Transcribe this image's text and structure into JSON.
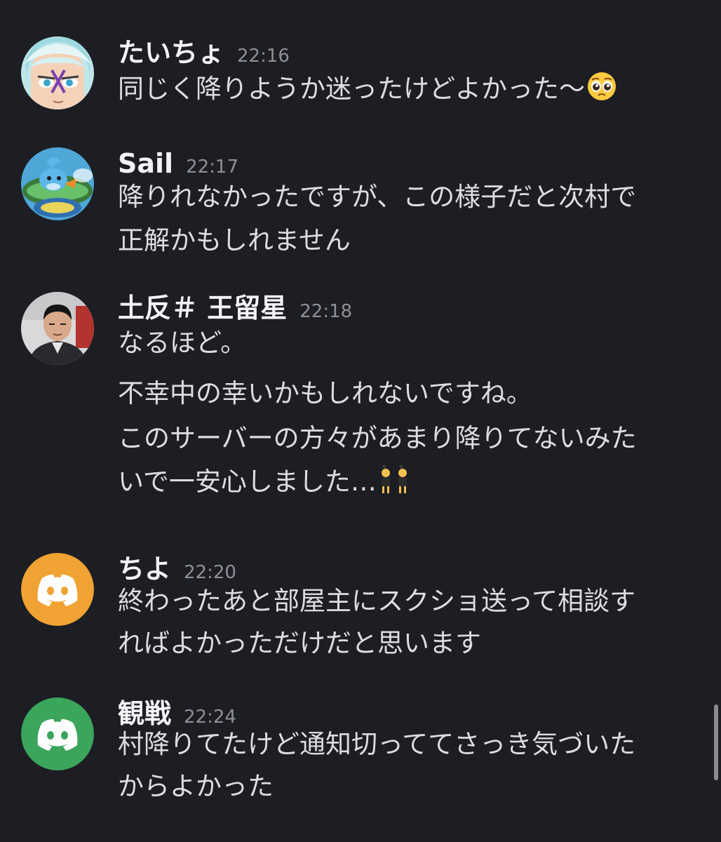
{
  "messages": [
    {
      "username": "たいちょ",
      "time": "22:16",
      "avatar": "anime-character-avatar",
      "lines": [
        "同じく降りようか迷ったけどよかった〜"
      ],
      "trailing_emoji": "pleading-face-emoji"
    },
    {
      "username": "Sail",
      "time": "22:17",
      "avatar": "pokemon-mudkip-avatar",
      "lines": [
        "降りれなかったですが、この様子だと次村で",
        "正解かもしれません"
      ]
    },
    {
      "username": "土反＃ 王留星",
      "time": "22:18",
      "avatar": "photo-person-avatar",
      "lines": [
        "なるほど。",
        "不幸中の幸いかもしれないですね。",
        "このサーバーの方々があまり降りてないみた",
        "いで一安心しました…"
      ],
      "trailing_emoji": "women-with-bunny-ears-emoji"
    },
    {
      "username": "ちよ",
      "time": "22:20",
      "avatar": "discord-default-avatar",
      "avatar_color": "#f0a232",
      "lines": [
        "終わったあと部屋主にスクショ送って相談す",
        "ればよかっただけだと思います"
      ]
    },
    {
      "username": "観戦",
      "time": "22:24",
      "avatar": "discord-default-avatar",
      "avatar_color": "#3ba55c",
      "lines": [
        "村降りてたけど通知切っててさっき気づいた",
        "からよかった"
      ]
    }
  ],
  "colors": {
    "background": "#1d1e23",
    "username": "#f2f3f5",
    "timestamp": "#8e9097",
    "message_text": "#dcdde1"
  }
}
